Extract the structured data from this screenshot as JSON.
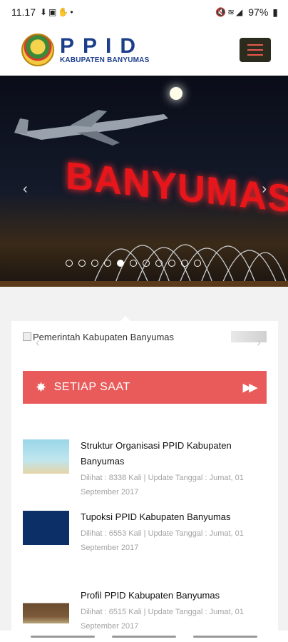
{
  "status": {
    "time": "11.17",
    "battery": "97%"
  },
  "header": {
    "title": "PPID",
    "subtitle": "KABUPATEN BANYUMAS"
  },
  "hero": {
    "sign": "BANYUMAS",
    "slide_count": 11,
    "active_slide": 4
  },
  "subslider": {
    "image_alt": "Pemerintah Kabupaten Banyumas"
  },
  "banner": {
    "label": "SETIAP SAAT"
  },
  "news": [
    {
      "title": "Struktur Organisasi PPID Kabupaten Banyumas",
      "meta": "Dilihat : 8338 Kali | Update Tanggal : Jumat, 01 September 2017"
    },
    {
      "title": "Tupoksi PPID Kabupaten Banyumas",
      "meta": "Dilihat : 6553 Kali | Update Tanggal : Jumat, 01 September 2017"
    },
    {
      "title": "Profil PPID Kabupaten Banyumas",
      "meta": "Dilihat : 6515 Kali | Update Tanggal : Jumat, 01 September 2017"
    }
  ],
  "colors": {
    "brand": "#1d3f8a",
    "accent": "#e95b5b",
    "menu_bg": "#2b2b1e"
  }
}
